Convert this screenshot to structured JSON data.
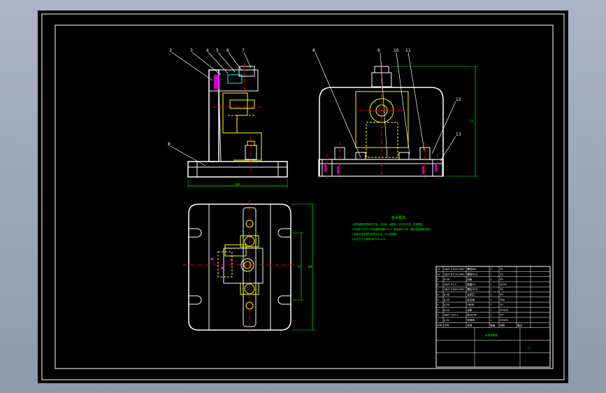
{
  "colors": {
    "background": "#000000",
    "frame": "#ffffff",
    "part_outline": "#ffffff",
    "hidden_lines": "#ffff00",
    "center_lines": "#ff0000",
    "dimensions": "#00ff00",
    "hatch": "#ff00ff",
    "highlight": "#00ffff"
  },
  "balloons": {
    "front_view": [
      "3",
      "3",
      "4",
      "5",
      "6",
      "7",
      "8"
    ],
    "side_view": [
      "8",
      "9",
      "10",
      "11",
      "12",
      "13"
    ]
  },
  "dimensions": {
    "front_width": "160",
    "side_height": "75",
    "plan_width": "70",
    "plan_length": "88"
  },
  "tech_requirements": {
    "title": "技术要求",
    "lines": [
      "1.零件装配前需清洗干净，去毛刺，装配后工件定位可靠，夹紧稳定。",
      "2.夹具定位元件工作表面粗糙度Ra1.6，配合面H7/g6，螺纹连接紧固可靠。",
      "3.各相对运动零件应转动灵活，无卡滞现象。",
      "4.未注尺寸公差按GB/T1804-m。"
    ]
  },
  "title_block": {
    "header_cols": [
      "序号",
      "代号",
      "名称",
      "数量",
      "材料",
      "备注"
    ],
    "parts": [
      [
        "11",
        "GB/T 5783-2000",
        "螺栓M8",
        "4",
        "35",
        ""
      ],
      [
        "10",
        "GB/T 6170-2000",
        "螺母M10",
        "2",
        "35",
        ""
      ],
      [
        "9",
        "JJ-09",
        "压板",
        "2",
        "45",
        ""
      ],
      [
        "8",
        "GB/T 97.1",
        "垫圈10",
        "2",
        "Q235",
        ""
      ],
      [
        "7",
        "GB/T 5782-2000",
        "螺栓M10",
        "2",
        "35",
        ""
      ],
      [
        "6",
        "JJ-06",
        "支承钉",
        "2",
        "45",
        ""
      ],
      [
        "5",
        "JJ-05",
        "定位销",
        "1",
        "T8A",
        ""
      ],
      [
        "4",
        "JJ-04",
        "V形块",
        "1",
        "20",
        ""
      ],
      [
        "3",
        "JJ-03",
        "支座",
        "1",
        "HT200",
        ""
      ],
      [
        "2",
        "GB/T 119.1",
        "销 8x30",
        "2",
        "45",
        ""
      ],
      [
        "1",
        "JJ-01",
        "夹具体",
        "1",
        "HT200",
        ""
      ]
    ],
    "drawing_title": "夹具装配图",
    "scale": "1:1"
  }
}
